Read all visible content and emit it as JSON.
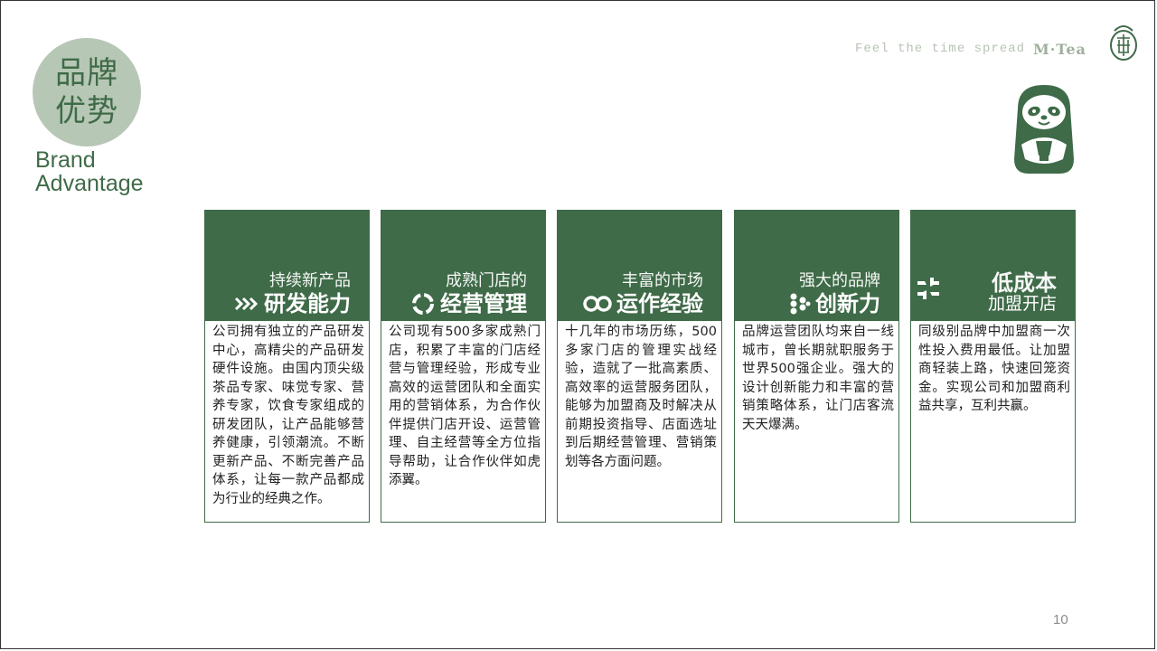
{
  "title": {
    "zh_line1": "品牌",
    "zh_line2": "优势",
    "en_line1": "Brand",
    "en_line2": "Advantage"
  },
  "header": {
    "slogan": "Feel the time spread",
    "brand": "M·Tea"
  },
  "cards": [
    {
      "head_top": "持续新产品",
      "head_main": "研发能力",
      "icon": "double-chevron-right-icon",
      "body": "公司拥有独立的产品研发中心，高精尖的产品研发硬件设施。由国内顶尖级茶品专家、味觉专家、营养专家，饮食专家组成的研发团队，让产品能够营养健康，引领潮流。不断更新产品、不断完善产品体系，让每一款产品都成为行业的经典之作。"
    },
    {
      "head_top": "成熟门店的",
      "head_main": "经营管理",
      "icon": "cycle-arrows-icon",
      "body": "公司现有500多家成熟门店，积累了丰富的门店经营与管理经验，形成专业高效的运营团队和全面实用的营销体系，为合作伙伴提供门店开设、运营管理、自主经营等全方位指导帮助，让合作伙伴如虎添翼。"
    },
    {
      "head_top": "丰富的市场",
      "head_main": "运作经验",
      "icon": "infinity-icon",
      "body": "十几年的市场历练，500多家门店的管理实战经验，造就了一批高素质、高效率的运营服务团队，能够为加盟商及时解决从前期投资指导、店面选址到后期经营管理、营销策划等各方面问题。"
    },
    {
      "head_top": "强大的品牌",
      "head_main": "创新力",
      "icon": "molecule-icon",
      "body": "品牌运营团队均来自一线城市，曾长期就职服务于世界500强企业。强大的设计创新能力和丰富的营销策略体系，让门店客流天天爆满。"
    },
    {
      "head_top": "低成本",
      "head_main": "加盟开店",
      "icon": "cross-blocks-icon",
      "body": "同级别品牌中加盟商一次性投入费用最低。让加盟商轻装上路，快速回笼资金。实现公司和加盟商利益共享，互利共赢。"
    }
  ],
  "page_number": "10",
  "colors": {
    "primary": "#3f6b48",
    "circle": "#b7c7b5",
    "slogan": "#b8c4b5"
  }
}
